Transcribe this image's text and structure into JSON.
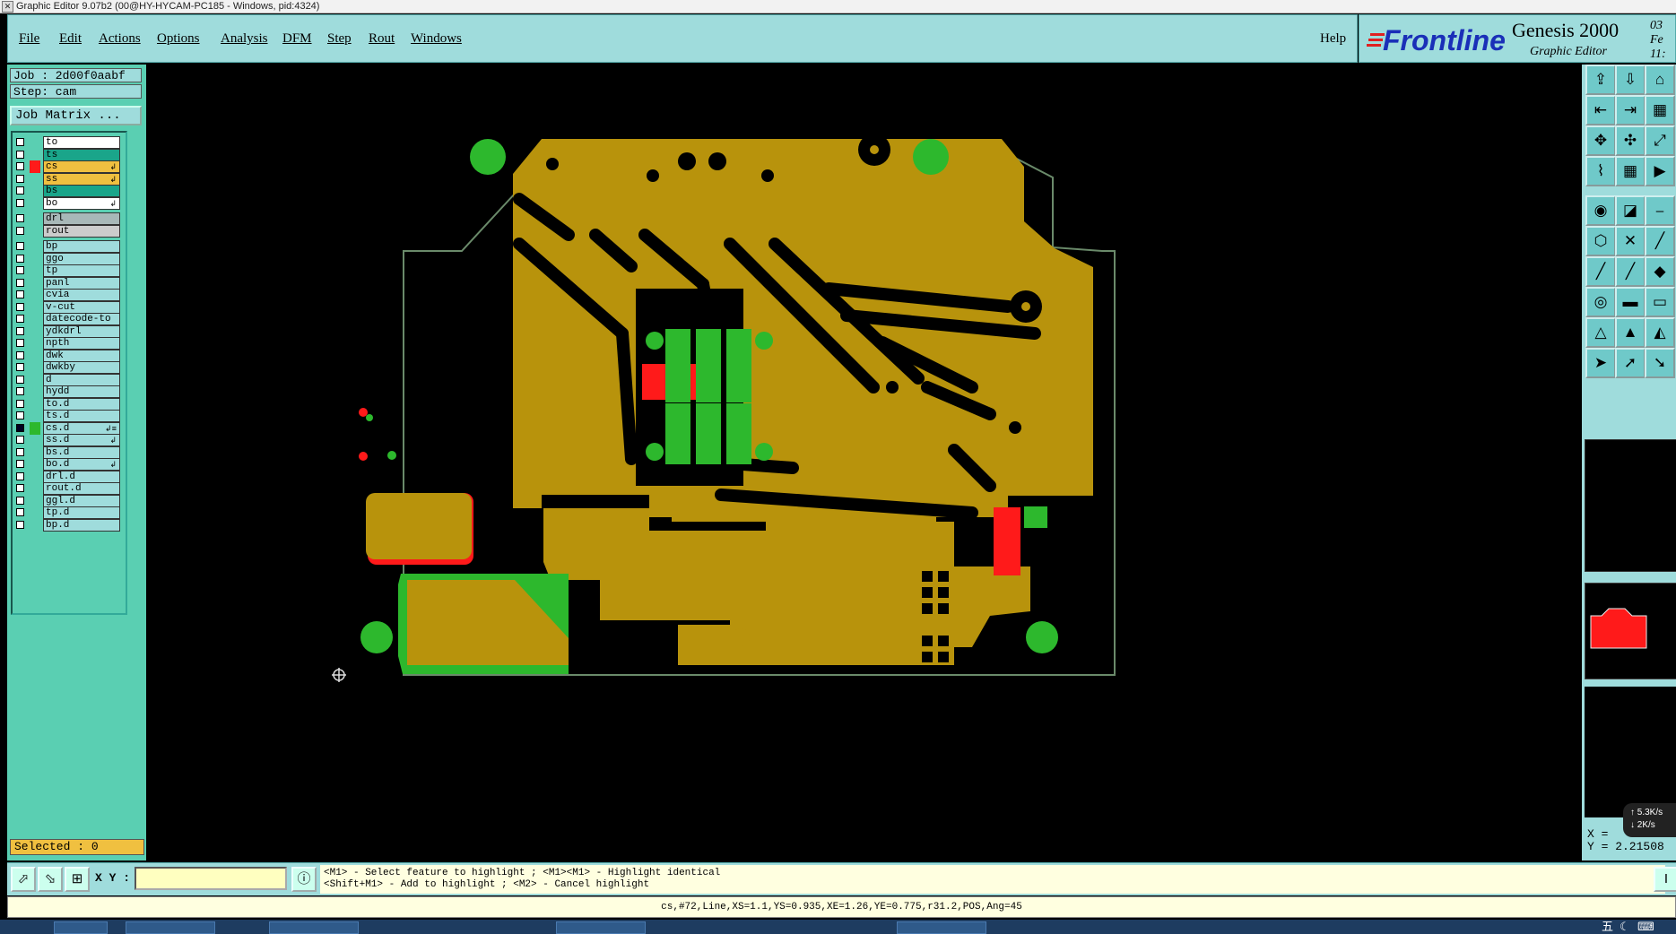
{
  "window": {
    "title": "Graphic Editor 9.07b2 (00@HY-HYCAM-PC185 - Windows, pid:4324)"
  },
  "menu": {
    "items": [
      "File",
      "Edit",
      "Actions",
      "Options",
      "Analysis",
      "DFM",
      "Step",
      "Rout",
      "Windows"
    ],
    "help": "Help"
  },
  "brand": {
    "logo": "Frontline",
    "product": "Genesis 2000",
    "subtitle": "Graphic Editor",
    "date_line1": "03 Fe",
    "date_line2": "11:"
  },
  "job": {
    "job": "Job : 2d00f0aabf",
    "step": "Step: cam",
    "matrix_button": "Job Matrix ..."
  },
  "layers": [
    {
      "name": "to",
      "bg": "#ffffff",
      "swatch": "",
      "flag": "",
      "checked": false
    },
    {
      "name": "ts",
      "bg": "#1aa58a",
      "swatch": "",
      "flag": "",
      "checked": false
    },
    {
      "name": "cs",
      "bg": "#f0c040",
      "swatch": "#ff1a1a",
      "flag": "↲",
      "checked": false
    },
    {
      "name": "ss",
      "bg": "#f0c040",
      "swatch": "",
      "flag": "↲",
      "checked": false
    },
    {
      "name": "bs",
      "bg": "#1aa58a",
      "swatch": "",
      "flag": "",
      "checked": false
    },
    {
      "name": "bo",
      "bg": "#ffffff",
      "swatch": "",
      "flag": "↲",
      "checked": false
    },
    {
      "name": "drl",
      "bg": "#a8b8b8",
      "swatch": "",
      "flag": "",
      "checked": false
    },
    {
      "name": "rout",
      "bg": "#cccccc",
      "swatch": "",
      "flag": "",
      "checked": false
    },
    {
      "name": "bp",
      "bg": "#9fdcdc",
      "swatch": "",
      "flag": "",
      "checked": false
    },
    {
      "name": "ggo",
      "bg": "#9fdcdc",
      "swatch": "",
      "flag": "",
      "checked": false
    },
    {
      "name": "tp",
      "bg": "#9fdcdc",
      "swatch": "",
      "flag": "",
      "checked": false
    },
    {
      "name": "panl",
      "bg": "#9fdcdc",
      "swatch": "",
      "flag": "",
      "checked": false
    },
    {
      "name": "cvia",
      "bg": "#9fdcdc",
      "swatch": "",
      "flag": "",
      "checked": false
    },
    {
      "name": "v-cut",
      "bg": "#9fdcdc",
      "swatch": "",
      "flag": "",
      "checked": false
    },
    {
      "name": "datecode-to",
      "bg": "#9fdcdc",
      "swatch": "",
      "flag": "",
      "checked": false
    },
    {
      "name": "ydkdrl",
      "bg": "#9fdcdc",
      "swatch": "",
      "flag": "",
      "checked": false
    },
    {
      "name": "npth",
      "bg": "#9fdcdc",
      "swatch": "",
      "flag": "",
      "checked": false
    },
    {
      "name": "dwk",
      "bg": "#9fdcdc",
      "swatch": "",
      "flag": "",
      "checked": false
    },
    {
      "name": "dwkby",
      "bg": "#9fdcdc",
      "swatch": "",
      "flag": "",
      "checked": false
    },
    {
      "name": "d",
      "bg": "#9fdcdc",
      "swatch": "",
      "flag": "",
      "checked": false
    },
    {
      "name": "hydd",
      "bg": "#9fdcdc",
      "swatch": "",
      "flag": "",
      "checked": false
    },
    {
      "name": "to.d",
      "bg": "#9fdcdc",
      "swatch": "",
      "flag": "",
      "checked": false
    },
    {
      "name": "ts.d",
      "bg": "#9fdcdc",
      "swatch": "",
      "flag": "",
      "checked": false
    },
    {
      "name": "cs.d",
      "bg": "#9fdcdc",
      "swatch": "#2db82d",
      "flag": "↲≡",
      "checked": true
    },
    {
      "name": "ss.d",
      "bg": "#9fdcdc",
      "swatch": "",
      "flag": "↲",
      "checked": false
    },
    {
      "name": "bs.d",
      "bg": "#9fdcdc",
      "swatch": "",
      "flag": "",
      "checked": false
    },
    {
      "name": "bo.d",
      "bg": "#9fdcdc",
      "swatch": "",
      "flag": "↲",
      "checked": false
    },
    {
      "name": "drl.d",
      "bg": "#9fdcdc",
      "swatch": "",
      "flag": "",
      "checked": false
    },
    {
      "name": "rout.d",
      "bg": "#9fdcdc",
      "swatch": "",
      "flag": "",
      "checked": false
    },
    {
      "name": "ggl.d",
      "bg": "#9fdcdc",
      "swatch": "",
      "flag": "",
      "checked": false
    },
    {
      "name": "tp.d",
      "bg": "#9fdcdc",
      "swatch": "",
      "flag": "",
      "checked": false
    },
    {
      "name": "bp.d",
      "bg": "#9fdcdc",
      "swatch": "",
      "flag": "",
      "checked": false
    }
  ],
  "selected": "Selected : 0",
  "colors": {
    "copper": "#b8930c",
    "board_edge": "#6a8a6a",
    "layer1": "#ff1a1a",
    "layer2": "#2db82d",
    "panel": "#9fdcdc",
    "canvas": "#000000"
  },
  "toolbar_icons": [
    "open-icon",
    "save-icon",
    "home-icon",
    "fit-icon",
    "prev-icon",
    "zoom-in-icon",
    "zoom-all-icon",
    "pan-icon",
    "scale-icon",
    "snap-icon",
    "grid-icon",
    "measure-icon",
    "select-icon",
    "edit-shape-icon",
    "ruler-icon",
    "connect-icon",
    "cross-icon",
    "line-icon",
    "draw-line-icon",
    "draw-arc-icon",
    "draw-poly-icon",
    "pad-icon",
    "minus-icon",
    "segment-icon",
    "triangle-icon",
    "text-a-icon",
    "text-b-icon",
    "pointer-icon",
    "pointer-box-icon",
    "pointer-alt-icon"
  ],
  "coords": {
    "x": "X =",
    "y": "Y = 2.21508"
  },
  "net": {
    "up": "5.3K/s",
    "down": "2K/s"
  },
  "bottom": {
    "xy_label": "X Y :",
    "xy_value": "",
    "hint_line1": "<M1> - Select feature to highlight ; <M1><M1> - Highlight identical",
    "hint_line2": "<Shift+M1> - Add to highlight ; <M2> - Cancel highlight",
    "right_button": "I"
  },
  "status": "cs,#72,Line,XS=1.1,YS=0.935,XE=1.26,YE=0.775,r31.2,POS,Ang=45",
  "tray": {
    "ime": "五"
  }
}
